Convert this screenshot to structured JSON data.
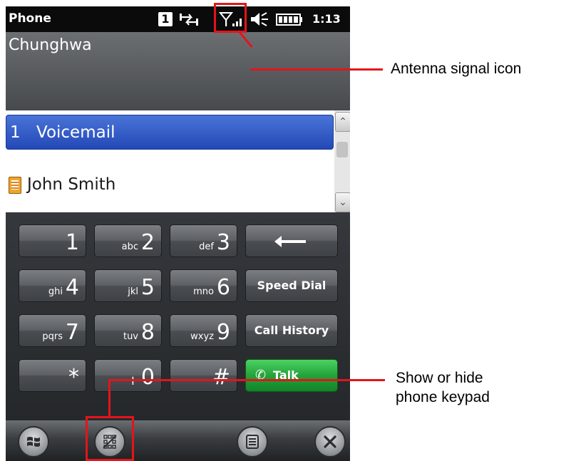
{
  "status_bar": {
    "app_title": "Phone",
    "sim_label": "1",
    "time": "1:13"
  },
  "carrier": {
    "name": "Chunghwa"
  },
  "list": {
    "voicemail": {
      "number": "1",
      "label": "Voicemail"
    },
    "contact": {
      "label": "John Smith",
      "icon": "contact-card-icon"
    }
  },
  "keypad": {
    "rows": [
      [
        {
          "digit": "1",
          "letters": ""
        },
        {
          "digit": "2",
          "letters": "abc"
        },
        {
          "digit": "3",
          "letters": "def"
        }
      ],
      [
        {
          "digit": "4",
          "letters": "ghi"
        },
        {
          "digit": "5",
          "letters": "jkl"
        },
        {
          "digit": "6",
          "letters": "mno"
        }
      ],
      [
        {
          "digit": "7",
          "letters": "pqrs"
        },
        {
          "digit": "8",
          "letters": "tuv"
        },
        {
          "digit": "9",
          "letters": "wxyz"
        }
      ],
      [
        {
          "digit": "*",
          "letters": ""
        },
        {
          "digit": "0",
          "letters": "+"
        },
        {
          "digit": "#",
          "letters": ""
        }
      ]
    ],
    "speed_dial": "Speed Dial",
    "call_history": "Call History",
    "talk": "Talk"
  },
  "callouts": {
    "antenna": "Antenna signal icon",
    "keypad_line1": "Show or hide",
    "keypad_line2": "phone keypad"
  },
  "colors": {
    "callout_red": "#e4141b",
    "talk_green": "#24a33b",
    "selection_blue": "#2f56c4"
  }
}
